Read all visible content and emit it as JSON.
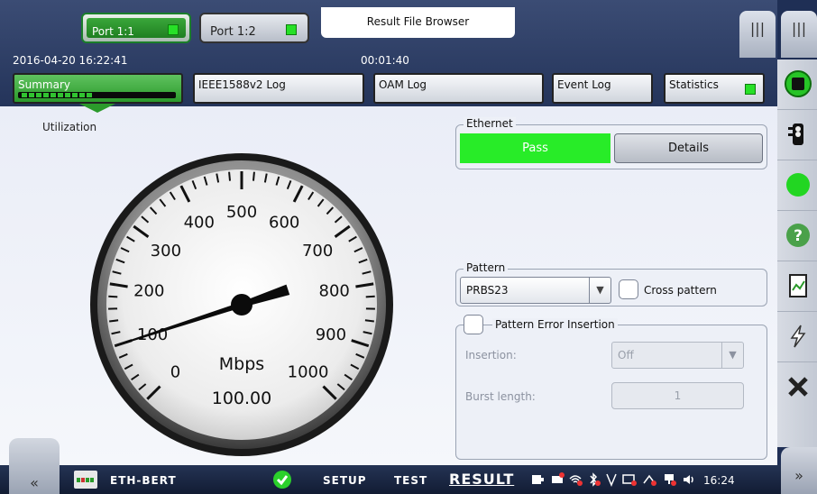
{
  "header": {
    "ports": [
      {
        "label": "Port 1:1",
        "active": true
      },
      {
        "label": "Port 1:2",
        "active": false
      }
    ],
    "result_file_browser": "Result File Browser",
    "datetime": "2016-04-20 16:22:41",
    "elapsed": "00:01:40",
    "tabs": [
      {
        "label": "Summary"
      },
      {
        "label": "IEEE1588v2 Log"
      },
      {
        "label": "OAM Log"
      },
      {
        "label": "Event Log"
      },
      {
        "label": "Statistics"
      }
    ]
  },
  "utilization": {
    "title": "Utilization",
    "unit": "Mbps",
    "value_text": "100.00",
    "value": 100,
    "scale_min": 0,
    "scale_max": 1000,
    "tick_labels": [
      "0",
      "100",
      "200",
      "300",
      "400",
      "500",
      "600",
      "700",
      "800",
      "900",
      "1000"
    ]
  },
  "ethernet": {
    "title": "Ethernet",
    "status": "Pass",
    "details_label": "Details"
  },
  "pattern": {
    "title": "Pattern",
    "selected": "PRBS23",
    "cross_pattern_label": "Cross pattern",
    "cross_pattern_checked": false
  },
  "error_insertion": {
    "title": "Pattern Error Insertion",
    "checked": false,
    "insertion_label": "Insertion:",
    "insertion_value": "Off",
    "burst_label": "Burst length:",
    "burst_value": "1"
  },
  "bottom": {
    "test_name": "ETH-BERT",
    "setup": "SETUP",
    "test": "TEST",
    "result": "RESULT",
    "clock": "16:24"
  },
  "colors": {
    "pass_green": "#28ec28",
    "led_green": "#27e027",
    "header_blue": "#24345a"
  }
}
